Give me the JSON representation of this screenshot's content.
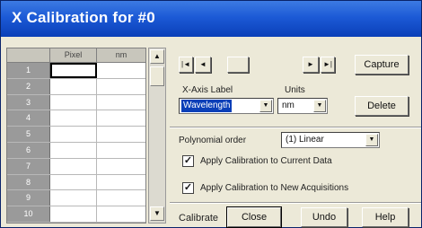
{
  "window": {
    "title": "X Calibration for #0"
  },
  "grid": {
    "columns": [
      "",
      "Pixel",
      "nm"
    ],
    "rows": [
      "1",
      "2",
      "3",
      "4",
      "5",
      "6",
      "7",
      "8",
      "9",
      "10"
    ]
  },
  "nav": {
    "first": "|◄",
    "prev": "◄",
    "next": "►",
    "last": "►|"
  },
  "xaxis": {
    "label": "X-Axis Label",
    "value": "Wavelength"
  },
  "units": {
    "label": "Units",
    "value": "nm"
  },
  "poly": {
    "label": "Polynomial order",
    "value": "(1) Linear"
  },
  "checks": {
    "current": "Apply Calibration to Current Data",
    "new": "Apply Calibration to New Acquisitions"
  },
  "buttons": {
    "capture": "Capture",
    "delete": "Delete",
    "calibrate": "Calibrate",
    "close": "Close",
    "undo": "Undo",
    "help": "Help"
  }
}
